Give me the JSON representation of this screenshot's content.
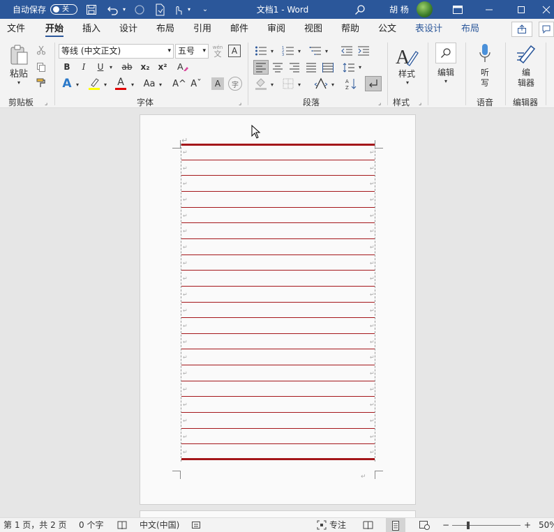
{
  "titlebar": {
    "autosave_label": "自动保存",
    "autosave_state": "关",
    "title": "文档1  -  Word",
    "user": "胡 杨",
    "save_icon": "save-icon",
    "undo_icon": "undo-icon",
    "redo_icon": "redo-icon",
    "accent": "#2b579a"
  },
  "tabs": [
    "文件",
    "开始",
    "插入",
    "设计",
    "布局",
    "引用",
    "邮件",
    "审阅",
    "视图",
    "帮助",
    "公文",
    "表设计",
    "布局"
  ],
  "ribbon": {
    "clipboard": {
      "paste": "粘贴",
      "group": "剪贴板"
    },
    "font": {
      "name": "等线 (中文正文)",
      "size": "五号",
      "wen": "wén",
      "wen_char": "文",
      "box_char": "A",
      "bold": "B",
      "italic": "I",
      "underline": "U",
      "strike": "ab",
      "sub": "x₂",
      "sup": "x²",
      "text_effect": "A",
      "font_color": "A",
      "change_case": "Aa",
      "grow": "A^",
      "shrink": "Aˇ",
      "shade_char": "A",
      "enclose": "字",
      "group": "字体",
      "highlight_color": "#ffff00",
      "font_color_value": "#e00000"
    },
    "paragraph": {
      "group": "段落"
    },
    "styles": {
      "label": "样式",
      "group": "样式"
    },
    "editing": {
      "label": "编辑"
    },
    "voice": {
      "label": "听\n写",
      "l1": "听",
      "l2": "写",
      "group": "语音"
    },
    "editor": {
      "l1": "编",
      "l2": "辑器",
      "group": "编辑器"
    }
  },
  "document": {
    "rule_color": "#a4161a",
    "para_mark": "↵"
  },
  "status": {
    "page": "第 1 页，共 2 页",
    "words": "0 个字",
    "lang": "中文(中国)",
    "focus": "专注",
    "zoom": "50%",
    "minus": "−",
    "plus": "+"
  }
}
